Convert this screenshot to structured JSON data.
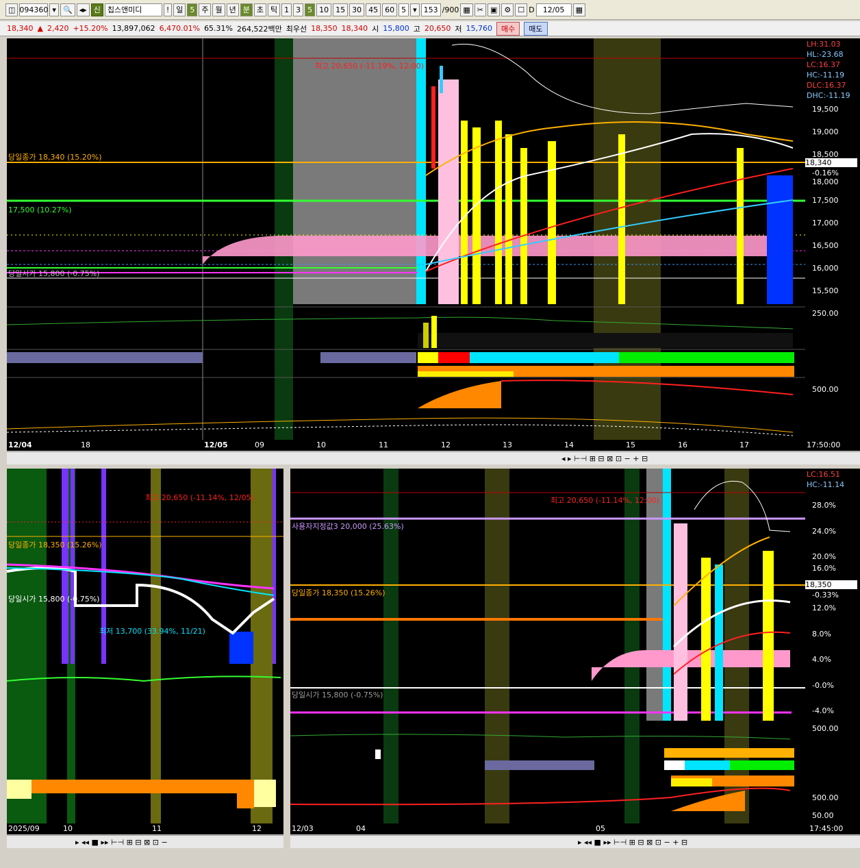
{
  "toolbar": {
    "code": "094360",
    "badge": "신",
    "name": "칩스앤미디",
    "alert": "!",
    "periods": [
      "일",
      "5",
      "주",
      "월",
      "년",
      "분",
      "초",
      "틱"
    ],
    "minutes": [
      "1",
      "3",
      "5",
      "10",
      "15",
      "30",
      "45",
      "60"
    ],
    "active_minute": "5",
    "interval_value": "5",
    "count": "153",
    "count_total": "/900",
    "d_label": "D",
    "date": "12/05"
  },
  "quote": {
    "price": "18,340",
    "change": "2,420",
    "pct": "+15.20%",
    "volume": "13,897,062",
    "vol_diff": "6,470.01%",
    "vol_ratio": "65.31%",
    "amount": "264,522백만",
    "best_label": "최우선",
    "bid": "18,350",
    "ask": "18,340",
    "open_label": "시",
    "open": "15,800",
    "high_label": "고",
    "high": "20,650",
    "low_label": "저",
    "low": "15,760",
    "buy": "매수",
    "sell": "매도"
  },
  "top": {
    "scale": [
      "19,500",
      "19,000",
      "18,500",
      "18,000",
      "17,500",
      "17,000",
      "16,500",
      "16,000",
      "15,500"
    ],
    "right_info": [
      "LH:31.03",
      "HL:-23.68",
      "LC:16.37",
      "HC:-11.19",
      "DLC:16.37",
      "DHC:-11.19"
    ],
    "current_price": "18,340",
    "current_pct": "-0.16%",
    "high_label": "최고 20,650 (-11.19%, 12:00)",
    "close_label": "당일종가 18,340 (15.20%)",
    "line_label": "17,500 (10.27%)",
    "open_label": "당일시가 15,800 (-0.75%)",
    "ind_scale1": "250.00",
    "ind_scale2": "500.00",
    "x_labels": [
      "12/04",
      "18",
      "12/05",
      "09",
      "10",
      "11",
      "12",
      "13",
      "14",
      "15",
      "16",
      "17"
    ],
    "time": "17:50:00"
  },
  "bottom_left": {
    "high_label": "최고 20,650 (-11.14%, 12/05)",
    "close_label": "당일종가 18,350 (15.26%)",
    "open_label": "당일시가 15,800 (-0.75%)",
    "low_label": "최저 13,700 (33.94%, 11/21)",
    "x_labels": [
      "2025/09",
      "10",
      "11",
      "12"
    ]
  },
  "bottom_right": {
    "info": [
      "LC:16.51",
      "HC:-11.14"
    ],
    "high_label": "최고 20,650 (-11.14%, 12:00)",
    "user_label": "사용자지정값3 20,000 (25.63%)",
    "close_label": "당일종가 18,350 (15.26%)",
    "open_label": "당일시가 15,800 (-0.75%)",
    "scale": [
      "28.0%",
      "24.0%",
      "20.0%",
      "16.0%",
      "12.0%",
      "8.0%",
      "4.0%",
      "-0.0%",
      "-4.0%"
    ],
    "current_price": "18,350",
    "current_pct": "-0.33%",
    "ind_scale1": "500.00",
    "ind_scale2": "500.00",
    "ind_scale3": "50.00",
    "x_labels": [
      "12/03",
      "04",
      "05"
    ],
    "time": "17:45:00"
  },
  "colors": {
    "up": "#ff2020",
    "down": "#3399ff",
    "bg": "#000000",
    "yellow": "#ffff00",
    "green": "#00ff00",
    "pink": "#ff99cc",
    "cyan": "#00e5ff",
    "orange": "#ff8800"
  }
}
